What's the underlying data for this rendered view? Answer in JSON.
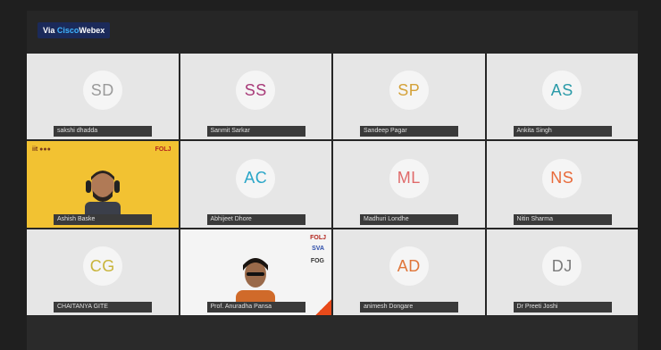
{
  "badge": {
    "prefix": "Via ",
    "brand": "Cisco",
    "suffix": "Webex"
  },
  "participants": [
    {
      "initials": "SD",
      "name": "sakshi dhadda",
      "color": "#9a9a9a"
    },
    {
      "initials": "SS",
      "name": "Sanmit Sarkar",
      "color": "#a83a78"
    },
    {
      "initials": "SP",
      "name": "Sandeep Pagar",
      "color": "#d4a23a"
    },
    {
      "initials": "AS",
      "name": "Ankita Singh",
      "color": "#2a9aa8"
    },
    {
      "initials": "",
      "name": "Ashish Baske",
      "color": ""
    },
    {
      "initials": "AC",
      "name": "Abhijeet Dhore",
      "color": "#2aa6c8"
    },
    {
      "initials": "ML",
      "name": "Madhuri Londhe",
      "color": "#e06a6a"
    },
    {
      "initials": "NS",
      "name": "Nitin Sharma",
      "color": "#e86a3a"
    },
    {
      "initials": "CG",
      "name": "CHAITANYA GITE",
      "color": "#c8b43a"
    },
    {
      "initials": "",
      "name": "Prof. Anuradha Pansa",
      "color": ""
    },
    {
      "initials": "AD",
      "name": "animesh Dongare",
      "color": "#e0763a"
    },
    {
      "initials": "DJ",
      "name": "Dr Preeti Joshi",
      "color": "#7a7a7a"
    }
  ],
  "logos": {
    "tile4_left": "iit ●●● ",
    "tile4_right": "FOLJ",
    "tile9_right1": "FOLJ",
    "tile9_right2": "SVA",
    "tile9_right3": "FOG"
  }
}
